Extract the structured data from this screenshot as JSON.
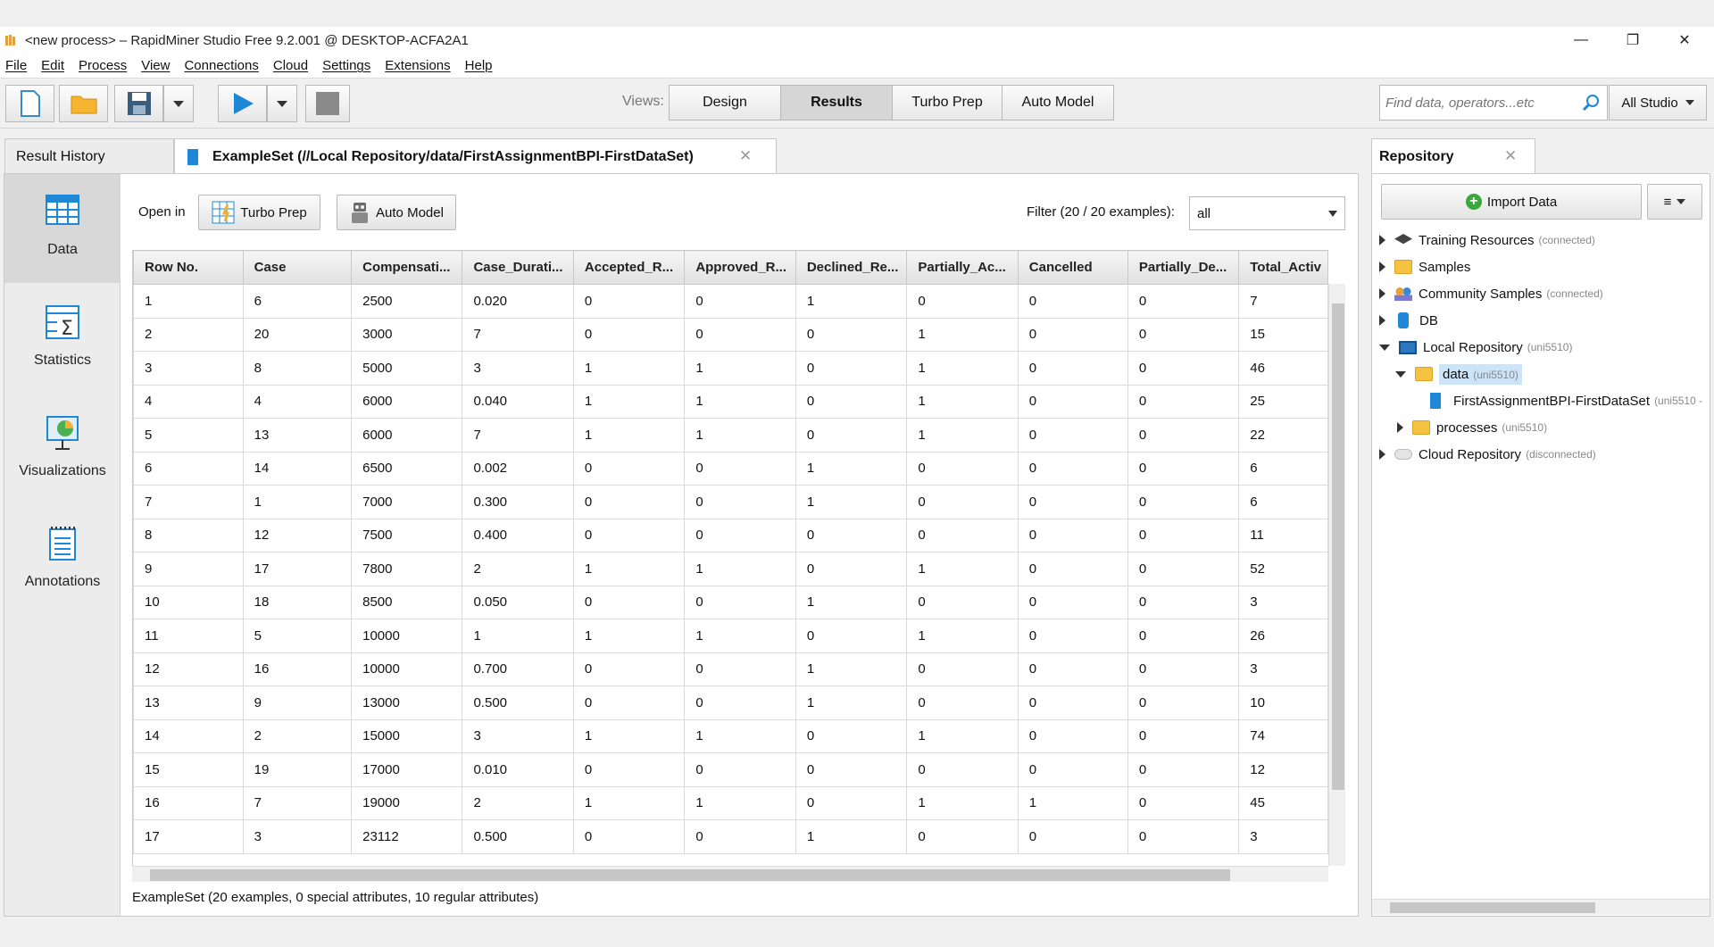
{
  "window": {
    "title": "<new process> – RapidMiner Studio Free 9.2.001 @ DESKTOP-ACFA2A1",
    "minimize": "—",
    "restore": "❐",
    "close": "✕"
  },
  "menu": [
    "File",
    "Edit",
    "Process",
    "View",
    "Connections",
    "Cloud",
    "Settings",
    "Extensions",
    "Help"
  ],
  "toolbar": {
    "views_label": "Views:",
    "views": [
      "Design",
      "Results",
      "Turbo Prep",
      "Auto Model"
    ],
    "active_view": "Results",
    "search_placeholder": "Find data, operators...etc",
    "scope": "All Studio"
  },
  "tabs": {
    "result_history": "Result History",
    "exampleset": "ExampleSet (//Local Repository/data/FirstAssignmentBPI-FirstDataSet)"
  },
  "sidenav": [
    "Data",
    "Statistics",
    "Visualizations",
    "Annotations"
  ],
  "dataview": {
    "open_in": "Open in",
    "turbo_prep": "Turbo Prep",
    "auto_model": "Auto Model",
    "filter_label": "Filter (20 / 20 examples):",
    "filter_value": "all",
    "columns": [
      "Row No.",
      "Case",
      "Compensati...",
      "Case_Durati...",
      "Accepted_R...",
      "Approved_R...",
      "Declined_Re...",
      "Partially_Ac...",
      "Cancelled",
      "Partially_De...",
      "Total_Activ"
    ],
    "rows": [
      [
        "1",
        "6",
        "2500",
        "0.020",
        "0",
        "0",
        "1",
        "0",
        "0",
        "0",
        "7"
      ],
      [
        "2",
        "20",
        "3000",
        "7",
        "0",
        "0",
        "0",
        "1",
        "0",
        "0",
        "15"
      ],
      [
        "3",
        "8",
        "5000",
        "3",
        "1",
        "1",
        "0",
        "1",
        "0",
        "0",
        "46"
      ],
      [
        "4",
        "4",
        "6000",
        "0.040",
        "1",
        "1",
        "0",
        "1",
        "0",
        "0",
        "25"
      ],
      [
        "5",
        "13",
        "6000",
        "7",
        "1",
        "1",
        "0",
        "1",
        "0",
        "0",
        "22"
      ],
      [
        "6",
        "14",
        "6500",
        "0.002",
        "0",
        "0",
        "1",
        "0",
        "0",
        "0",
        "6"
      ],
      [
        "7",
        "1",
        "7000",
        "0.300",
        "0",
        "0",
        "1",
        "0",
        "0",
        "0",
        "6"
      ],
      [
        "8",
        "12",
        "7500",
        "0.400",
        "0",
        "0",
        "0",
        "0",
        "0",
        "0",
        "11"
      ],
      [
        "9",
        "17",
        "7800",
        "2",
        "1",
        "1",
        "0",
        "1",
        "0",
        "0",
        "52"
      ],
      [
        "10",
        "18",
        "8500",
        "0.050",
        "0",
        "0",
        "1",
        "0",
        "0",
        "0",
        "3"
      ],
      [
        "11",
        "5",
        "10000",
        "1",
        "1",
        "1",
        "0",
        "1",
        "0",
        "0",
        "26"
      ],
      [
        "12",
        "16",
        "10000",
        "0.700",
        "0",
        "0",
        "1",
        "0",
        "0",
        "0",
        "3"
      ],
      [
        "13",
        "9",
        "13000",
        "0.500",
        "0",
        "0",
        "1",
        "0",
        "0",
        "0",
        "10"
      ],
      [
        "14",
        "2",
        "15000",
        "3",
        "1",
        "1",
        "0",
        "1",
        "0",
        "0",
        "74"
      ],
      [
        "15",
        "19",
        "17000",
        "0.010",
        "0",
        "0",
        "0",
        "0",
        "0",
        "0",
        "12"
      ],
      [
        "16",
        "7",
        "19000",
        "2",
        "1",
        "1",
        "0",
        "1",
        "1",
        "0",
        "45"
      ],
      [
        "17",
        "3",
        "23112",
        "0.500",
        "0",
        "0",
        "1",
        "0",
        "0",
        "0",
        "3"
      ]
    ],
    "status": "ExampleSet (20 examples, 0 special attributes, 10 regular attributes)"
  },
  "repository": {
    "tab": "Repository",
    "import": "Import Data",
    "menu_icon": "≡",
    "tree": [
      {
        "label": "Training Resources",
        "sub": "(connected)"
      },
      {
        "label": "Samples",
        "sub": ""
      },
      {
        "label": "Community Samples",
        "sub": "(connected)"
      },
      {
        "label": "DB",
        "sub": ""
      },
      {
        "label": "Local Repository",
        "sub": "(uni5510)"
      },
      {
        "label": "data",
        "sub": "(uni5510)"
      },
      {
        "label": "FirstAssignmentBPI-FirstDataSet",
        "sub": "(uni5510 -"
      },
      {
        "label": "processes",
        "sub": "(uni5510)"
      },
      {
        "label": "Cloud Repository",
        "sub": "(disconnected)"
      }
    ]
  },
  "colors": {
    "accent": "#1e88d6",
    "folder": "#f5c242",
    "selected": "#cde3f7"
  }
}
